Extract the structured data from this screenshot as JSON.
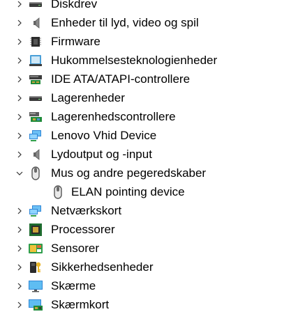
{
  "tree": {
    "items": [
      {
        "label": "Diskdrev",
        "icon": "disk-drive-icon",
        "expanded": false
      },
      {
        "label": "Enheder til lyd, video og spil",
        "icon": "speaker-icon",
        "expanded": false
      },
      {
        "label": "Firmware",
        "icon": "firmware-chip-icon",
        "expanded": false
      },
      {
        "label": "Hukommelsesteknologienheder",
        "icon": "memory-device-icon",
        "expanded": false
      },
      {
        "label": "IDE ATA/ATAPI-controllere",
        "icon": "ide-controller-icon",
        "expanded": false
      },
      {
        "label": "Lagerenheder",
        "icon": "storage-drive-icon",
        "expanded": false
      },
      {
        "label": "Lagerenhedscontrollere",
        "icon": "storage-controller-icon",
        "expanded": false
      },
      {
        "label": "Lenovo Vhid Device",
        "icon": "network-monitor-icon",
        "expanded": false
      },
      {
        "label": "Lydoutput og -input",
        "icon": "speaker-icon",
        "expanded": false
      },
      {
        "label": "Mus og andre pegeredskaber",
        "icon": "mouse-icon",
        "expanded": true,
        "children": [
          {
            "label": "ELAN pointing device",
            "icon": "mouse-icon"
          }
        ]
      },
      {
        "label": "Netværkskort",
        "icon": "network-monitor-icon",
        "expanded": false
      },
      {
        "label": "Processorer",
        "icon": "processor-icon",
        "expanded": false
      },
      {
        "label": "Sensorer",
        "icon": "sensor-icon",
        "expanded": false
      },
      {
        "label": "Sikkerhedsenheder",
        "icon": "security-key-icon",
        "expanded": false
      },
      {
        "label": "Skærme",
        "icon": "monitor-icon",
        "expanded": false
      },
      {
        "label": "Skærmkort",
        "icon": "display-adapter-icon",
        "expanded": false
      }
    ]
  }
}
